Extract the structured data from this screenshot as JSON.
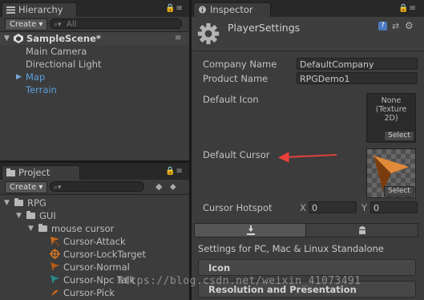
{
  "hierarchy": {
    "tab_label": "Hierarchy",
    "create_label": "Create",
    "search_placeholder": "All",
    "scene_name": "SampleScene*",
    "items": [
      "Main Camera",
      "Directional Light",
      "Map",
      "Terrain"
    ]
  },
  "project": {
    "tab_label": "Project",
    "create_label": "Create",
    "search_placeholder": "",
    "tree": {
      "root": "RPG",
      "child": "GUI",
      "subchild": "mouse cursor",
      "files": [
        "Cursor-Attack",
        "Cursor-LockTarget",
        "Cursor-Normal",
        "Cursor-Npc Talk",
        "Cursor-Pick"
      ]
    }
  },
  "inspector": {
    "tab_label": "Inspector",
    "title": "PlayerSettings",
    "company_name_label": "Company Name",
    "company_name_value": "DefaultCompany",
    "product_name_label": "Product Name",
    "product_name_value": "RPGDemo1",
    "default_icon_label": "Default Icon",
    "default_icon_none": "None",
    "default_icon_type": "(Texture",
    "default_icon_type2": "2D)",
    "default_cursor_label": "Default Cursor",
    "select_label": "Select",
    "cursor_hotspot_label": "Cursor Hotspot",
    "hotspot_x_label": "X",
    "hotspot_x_value": "0",
    "hotspot_y_label": "Y",
    "hotspot_y_value": "0",
    "settings_for": "Settings for PC, Mac & Linux Standalone",
    "sections": [
      "Icon",
      "Resolution and Presentation"
    ]
  },
  "watermark": "https://blog.csdn.net/weixin_41073491",
  "colors": {
    "link_blue": "#5a9fdb",
    "arrow_red": "#e8403a",
    "panel_bg": "#3c3c3c"
  }
}
